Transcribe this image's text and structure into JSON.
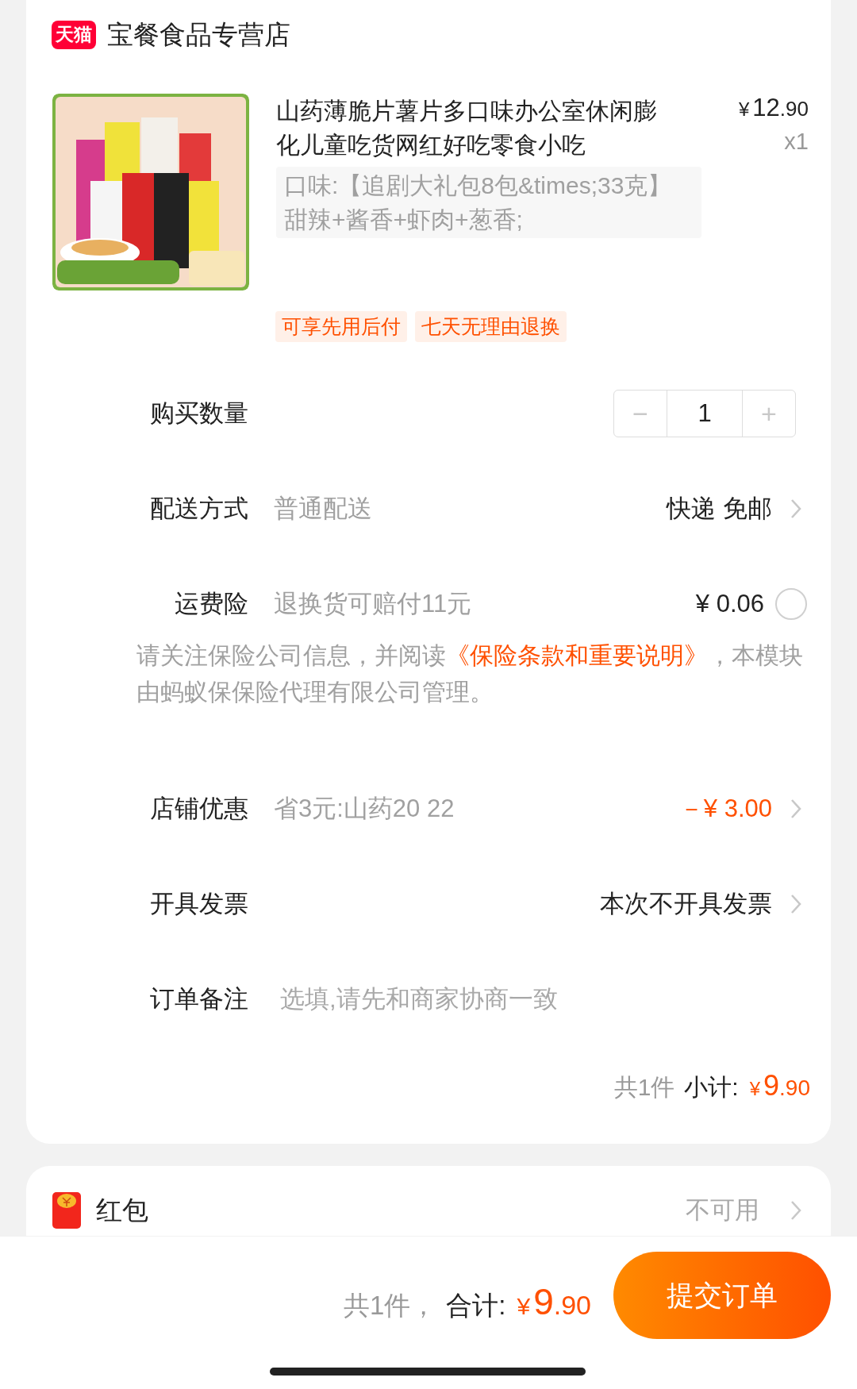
{
  "store": {
    "name": "宝餐食品专营店",
    "badge": "天猫"
  },
  "product": {
    "title": "山药薄脆片薯片多口味办公室休闲膨化儿童吃货网红好吃零食小吃",
    "price_symbol": "¥",
    "price_integer": "12",
    "price_decimal": ".90",
    "quantity": "x1",
    "spec": "口味:【追剧大礼包8包&times;33克】甜辣+酱香+虾肉+葱香;",
    "tags": [
      "可享先用后付",
      "七天无理由退换"
    ]
  },
  "rows": [
    {
      "kind": "stepper",
      "label": "购买数量",
      "value": "1",
      "minus": "−",
      "plus": "+"
    },
    {
      "kind": "link",
      "label": "配送方式",
      "detail": "普通配送",
      "value": "快递 免邮",
      "highlight": false
    },
    {
      "kind": "radio",
      "label": "运费险",
      "detail": "退换货可赔付11元",
      "value": "¥ 0.06",
      "selected": false
    },
    {
      "kind": "notice",
      "text_before": "请关注保险公司信息，并阅读",
      "link": "《保险条款和重要说明》",
      "text_after": "，本模块由蚂蚁保保险代理有限公司管理。"
    },
    {
      "kind": "link",
      "label": "店铺优惠",
      "detail": "省3元:山药20 22",
      "value": "－¥ 3.00",
      "highlight": true
    },
    {
      "kind": "link",
      "label": "开具发票",
      "value": "本次不开具发票",
      "highlight": false
    },
    {
      "kind": "input",
      "label": "订单备注",
      "placeholder": "选填,请先和商家协商一致"
    }
  ],
  "subtotal": {
    "count": "共1件",
    "label": "小计:",
    "price_symbol": "¥",
    "price_integer": "9",
    "price_decimal": ".90"
  },
  "red_packet": {
    "label": "红包",
    "value": "不可用"
  },
  "footer": {
    "count": "共1件，",
    "label": "合计:",
    "price_symbol": "¥",
    "price_integer": "9",
    "price_decimal": ".90",
    "submit": "提交订单"
  }
}
